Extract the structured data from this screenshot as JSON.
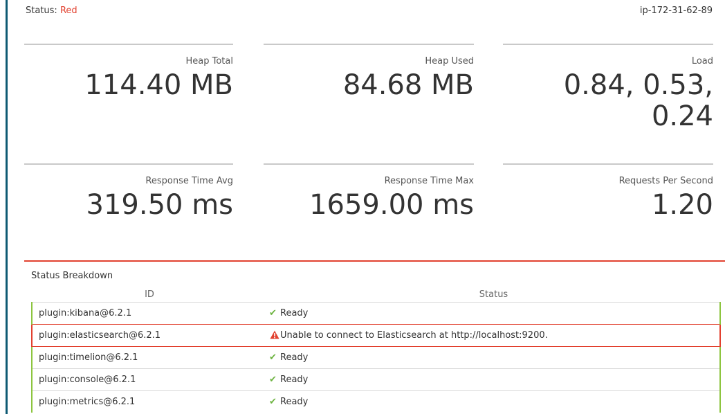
{
  "header": {
    "status_label": "Status: ",
    "status_value": "Red",
    "hostname": "ip-172-31-62-89"
  },
  "metrics": [
    {
      "title": "Heap Total",
      "value": "114.40 MB"
    },
    {
      "title": "Heap Used",
      "value": "84.68 MB"
    },
    {
      "title": "Load",
      "value": "0.84, 0.53, 0.24"
    },
    {
      "title": "Response Time Avg",
      "value": "319.50 ms"
    },
    {
      "title": "Response Time Max",
      "value": "1659.00 ms"
    },
    {
      "title": "Requests Per Second",
      "value": "1.20"
    }
  ],
  "breakdown": {
    "title": "Status Breakdown",
    "columns": {
      "id": "ID",
      "status": "Status"
    },
    "rows": [
      {
        "id": "plugin:kibana@6.2.1",
        "status": "Ready",
        "state": "green",
        "icon": "check-icon"
      },
      {
        "id": "plugin:elasticsearch@6.2.1",
        "status": "Unable to connect to Elasticsearch at http://localhost:9200.",
        "state": "red",
        "icon": "warning-icon"
      },
      {
        "id": "plugin:timelion@6.2.1",
        "status": "Ready",
        "state": "green",
        "icon": "check-icon"
      },
      {
        "id": "plugin:console@6.2.1",
        "status": "Ready",
        "state": "green",
        "icon": "check-icon"
      },
      {
        "id": "plugin:metrics@6.2.1",
        "status": "Ready",
        "state": "green",
        "icon": "check-icon"
      }
    ]
  },
  "colors": {
    "red": "#e2412f",
    "green": "#8dc540",
    "accent": "#0e5a73"
  }
}
